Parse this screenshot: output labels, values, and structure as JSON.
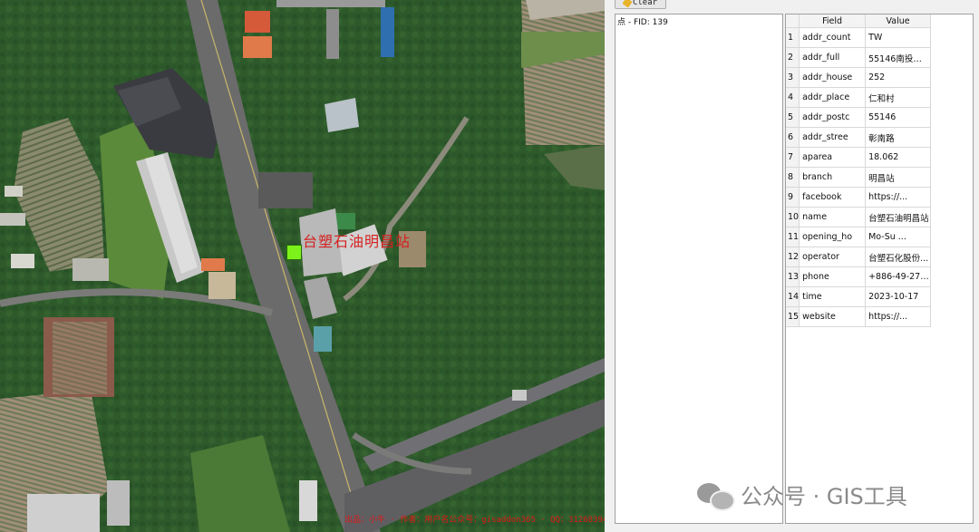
{
  "map": {
    "poi_label": "台塑石油明昌站",
    "footer_text": "出品：小牛 · 作者：用户名公众号：gisaddon365 · QQ：3126839456"
  },
  "toolbar": {
    "clear_label": "Clear"
  },
  "tree": {
    "item_label": "点 - FID: 139"
  },
  "attributes": {
    "header_field": "Field",
    "header_value": "Value",
    "rows": [
      {
        "n": "1",
        "field": "addr_count",
        "value": "TW"
      },
      {
        "n": "2",
        "field": "addr_full",
        "value": "55146南投縣名..."
      },
      {
        "n": "3",
        "field": "addr_house",
        "value": "252"
      },
      {
        "n": "4",
        "field": "addr_place",
        "value": "仁和村"
      },
      {
        "n": "5",
        "field": "addr_postc",
        "value": "55146"
      },
      {
        "n": "6",
        "field": "addr_stree",
        "value": "彰南路"
      },
      {
        "n": "7",
        "field": "aparea",
        "value": "18.062"
      },
      {
        "n": "8",
        "field": "branch",
        "value": "明昌站"
      },
      {
        "n": "9",
        "field": "facebook",
        "value": "https://..."
      },
      {
        "n": "10",
        "field": "name",
        "value": "台塑石油明昌站"
      },
      {
        "n": "11",
        "field": "opening_ho",
        "value": "Mo-Su ..."
      },
      {
        "n": "12",
        "field": "operator",
        "value": "台塑石化股份..."
      },
      {
        "n": "13",
        "field": "phone",
        "value": "+886-49-2731..."
      },
      {
        "n": "14",
        "field": "time",
        "value": "2023-10-17"
      },
      {
        "n": "15",
        "field": "website",
        "value": "https://..."
      }
    ]
  },
  "watermark": {
    "text": "公众号 · GIS工具"
  },
  "colors": {
    "marker": "#7cf21a",
    "label": "#d62020"
  }
}
